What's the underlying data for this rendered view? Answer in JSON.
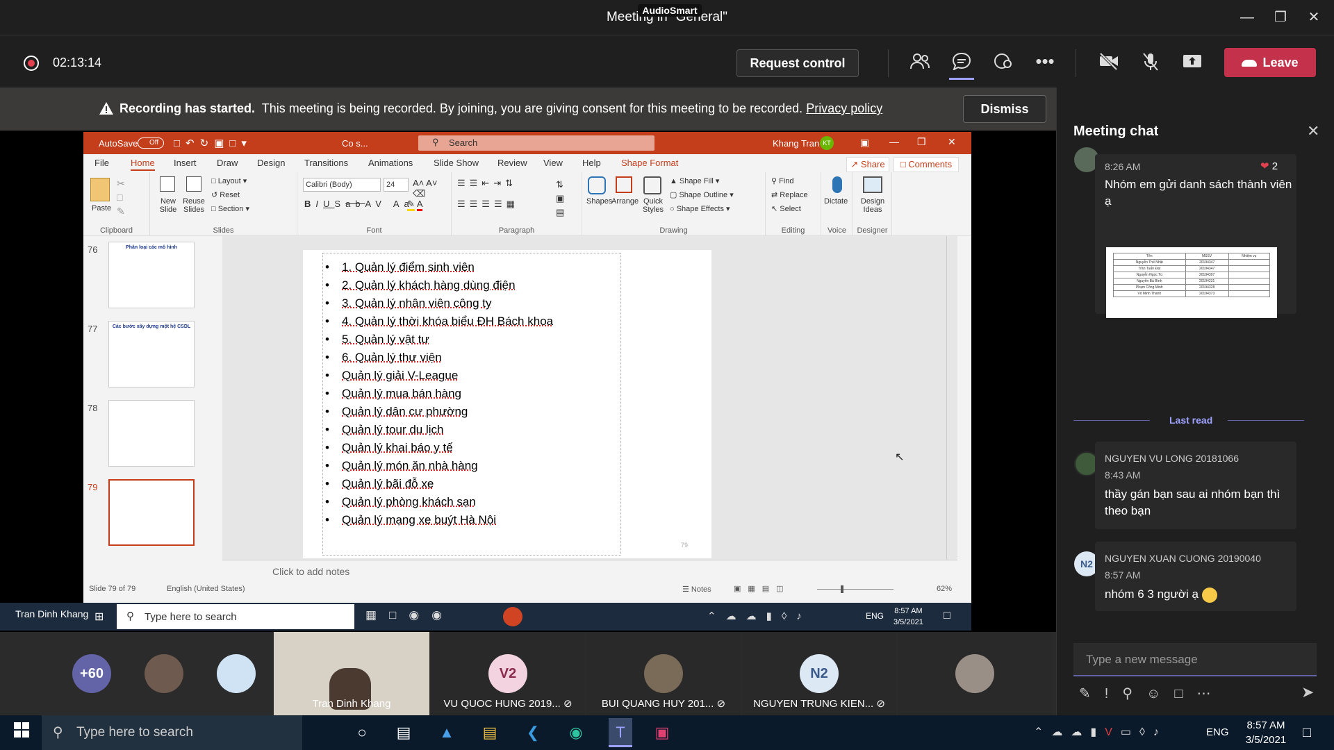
{
  "window": {
    "title": "Meeting in \"General\"",
    "overlay": "AudioSmart"
  },
  "meeting": {
    "timer": "02:13:14",
    "request_control": "Request control",
    "leave": "Leave"
  },
  "banner": {
    "bold": "Recording has started.",
    "text": "This meeting is being recorded. By joining, you are giving consent for this meeting to be recorded.",
    "link": "Privacy policy",
    "dismiss": "Dismiss"
  },
  "ppt": {
    "autosave": "AutoSave",
    "autosave_state": "Off",
    "file": "Co s...",
    "search": "Search",
    "user": "Khang Tran",
    "user_initials": "KT",
    "tabs": [
      "File",
      "Home",
      "Insert",
      "Draw",
      "Design",
      "Transitions",
      "Animations",
      "Slide Show",
      "Review",
      "View",
      "Help",
      "Shape Format"
    ],
    "share": "Share",
    "comments": "Comments",
    "ribbon": {
      "paste": "Paste",
      "clipboard": "Clipboard",
      "new_slide": "New Slide",
      "reuse_slides": "Reuse Slides",
      "layout": "Layout",
      "reset": "Reset",
      "section": "Section",
      "slides": "Slides",
      "font_name": "Calibri (Body)",
      "font_size": "24",
      "font": "Font",
      "paragraph": "Paragraph",
      "shapes": "Shapes",
      "arrange": "Arrange",
      "quick_styles": "Quick Styles",
      "shape_fill": "Shape Fill",
      "shape_outline": "Shape Outline",
      "shape_effects": "Shape Effects",
      "drawing": "Drawing",
      "find": "Find",
      "replace": "Replace",
      "select": "Select",
      "editing": "Editing",
      "dictate": "Dictate",
      "voice": "Voice",
      "design_ideas": "Design Ideas",
      "designer": "Designer"
    },
    "thumbs": [
      {
        "num": "76",
        "title": "Phân loại các mô hình"
      },
      {
        "num": "77",
        "title": "Các bước xây dựng một hệ CSDL"
      },
      {
        "num": "78",
        "title": ""
      },
      {
        "num": "79",
        "title": ""
      }
    ],
    "slide_items": [
      "1. Quản lý điểm sinh viên",
      "2. Quản lý khách hàng dùng điện",
      "3. Quản lý nhân viên công ty",
      "4. Quản lý thời khóa biểu ĐH Bách khoa",
      "5. Quản lý vật tư",
      "6. Quản lý thư viện",
      "Quản lý giải V-League",
      "Quản lý mua bán hàng",
      "Quản lý dân cư phường",
      "Quản lý tour du lịch",
      "Quản lý khai báo y tế",
      "Quản lý món ăn nhà hàng",
      "Quản lý bãi đỗ xe",
      "Quản lý phòng khách sạn",
      "Quản lý mạng xe buýt Hà Nội"
    ],
    "slide_number": "79",
    "notes": "Click to add notes",
    "status": {
      "slide": "Slide 79 of 79",
      "lang": "English (United States)",
      "notes": "Notes",
      "zoom": "62%"
    },
    "inner_taskbar": {
      "presenter": "Tran Dinh Khang",
      "search": "Type here to search",
      "lang": "ENG",
      "time": "8:57 AM",
      "date": "3/5/2021"
    }
  },
  "participants": [
    {
      "label": "+60",
      "color": "#6264a7"
    },
    {
      "name": "Tran Dinh Khang"
    },
    {
      "name": "VU QUOC HUNG 2019...",
      "initials": "V2",
      "color": "#f2d3df"
    },
    {
      "name": "BUI QUANG HUY 201..."
    },
    {
      "name": "NGUYEN TRUNG KIEN...",
      "initials": "N2",
      "color": "#dde8f5"
    }
  ],
  "chat": {
    "title": "Meeting chat",
    "msg1": {
      "time": "8:26 AM",
      "text": "Nhóm em gửi danh sách thành viên ạ",
      "reactions": "2"
    },
    "table": {
      "headers": [
        "Tên",
        "MSSV",
        "Nhiệm vụ"
      ],
      "rows": [
        [
          "Nguyễn Thế Nhật",
          "20194347",
          ""
        ],
        [
          "Trần Tuấn Đạt",
          "20194347",
          ""
        ],
        [
          "Nguyễn Ngọc Tú",
          "20194397",
          ""
        ],
        [
          "Nguyễn Bá Bình",
          "20194231",
          ""
        ],
        [
          "Phạm Công Minh",
          "20194328",
          ""
        ],
        [
          "Võ Minh Thành",
          "20194373",
          ""
        ]
      ]
    },
    "last_read": "Last read",
    "msg2": {
      "name": "NGUYEN VU LONG 20181066",
      "time": "8:43 AM",
      "text": "thầy gán bạn sau ai nhóm bạn thì theo bạn"
    },
    "msg3": {
      "name": "NGUYEN XUAN CUONG 20190040",
      "initials": "N2",
      "time": "8:57 AM",
      "text": "nhóm 6 3 người ạ"
    },
    "compose": "Type a new message"
  },
  "taskbar": {
    "search": "Type here to search",
    "lang": "ENG",
    "time": "8:57 AM",
    "date": "3/5/2021"
  }
}
